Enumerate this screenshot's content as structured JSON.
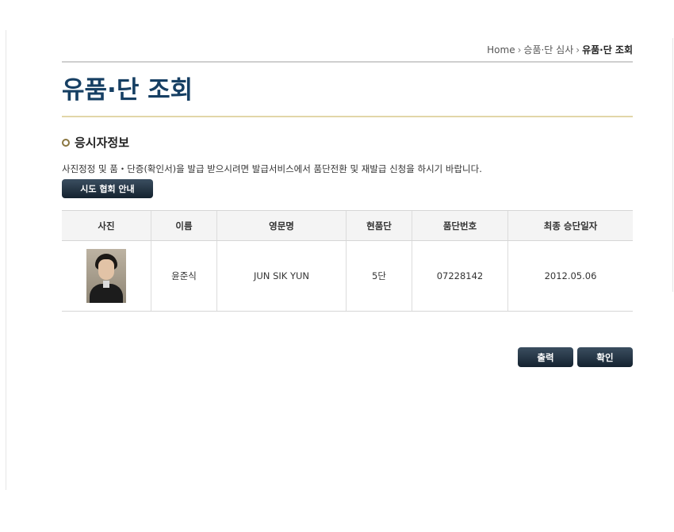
{
  "breadcrumb": {
    "home": "Home",
    "section": "승품·단 심사",
    "current": "유품·단 조회"
  },
  "page_title": "유품·단 조회",
  "section": {
    "title": "응시자정보"
  },
  "notice": "사진정정 및 품・단증(확인서)을 발급 받으시려면 발급서비스에서 품단전환 및 재발급 신청을 하시기 바랍니다.",
  "guide_button": "시도 협회 안내",
  "table": {
    "headers": [
      "사진",
      "이름",
      "영문명",
      "현품단",
      "품단번호",
      "최종 승단일자"
    ],
    "row": {
      "name": "윤준식",
      "english_name": "JUN SIK YUN",
      "rank": "5단",
      "rank_number": "07228142",
      "last_promotion_date": "2012.05.06"
    }
  },
  "buttons": {
    "print": "출력",
    "confirm": "확인"
  }
}
